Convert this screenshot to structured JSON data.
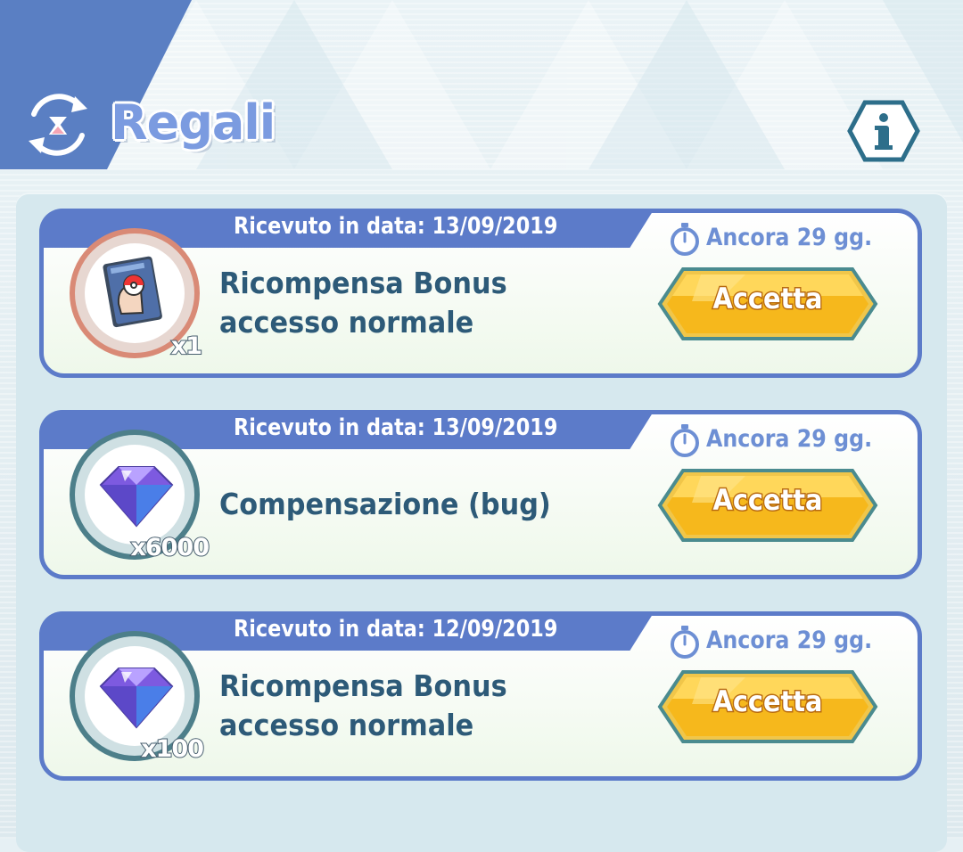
{
  "header": {
    "title": "Regali",
    "title_icon": "gift-exchange-icon",
    "info_icon": "info-icon"
  },
  "colors": {
    "header_blue": "#5a7fc3",
    "card_border": "#5c7bc9",
    "title_text": "#2d5a78",
    "timer_text": "#6d8fd4",
    "button_yellow": "#f5b71d"
  },
  "gifts": [
    {
      "received": "Ricevuto in data: 13/09/2019",
      "remaining": "Ancora 29 gg.",
      "title": "Ricompensa Bonus accesso normale",
      "item_icon": "trainer-book-icon",
      "quantity": "x1",
      "button": "Accetta"
    },
    {
      "received": "Ricevuto in data: 13/09/2019",
      "remaining": "Ancora 29 gg.",
      "title": "Compensazione (bug)",
      "item_icon": "gem-icon",
      "quantity": "x6000",
      "button": "Accetta"
    },
    {
      "received": "Ricevuto in data: 12/09/2019",
      "remaining": "Ancora 29 gg.",
      "title": "Ricompensa Bonus accesso normale",
      "item_icon": "gem-icon",
      "quantity": "x100",
      "button": "Accetta"
    }
  ]
}
